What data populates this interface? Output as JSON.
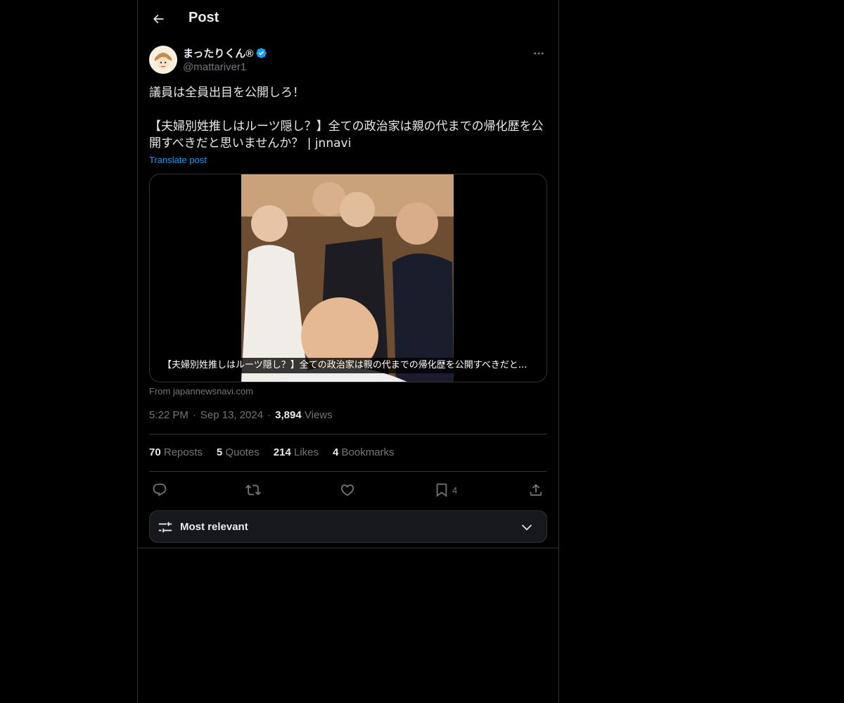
{
  "header": {
    "title": "Post"
  },
  "author": {
    "name": "まったりくん®",
    "handle": "@mattariver1"
  },
  "post": {
    "text": "議員は全員出目を公開しろ！\n\n【夫婦別姓推しはルーツ隠し？】全ての政治家は親の代までの帰化歴を公開すべきだと思いませんか？ | jnnavi",
    "translate_label": "Translate post"
  },
  "card": {
    "caption": "【夫婦別姓推しはルーツ隠し？】全ての政治家は親の代までの帰化歴を公開すべきだと...",
    "source": "From japannewsnavi.com"
  },
  "meta": {
    "time": "5:22 PM",
    "date": "Sep 13, 2024",
    "views_count": "3,894",
    "views_label": "Views"
  },
  "stats": {
    "reposts_count": "70",
    "reposts_label": "Reposts",
    "quotes_count": "5",
    "quotes_label": "Quotes",
    "likes_count": "214",
    "likes_label": "Likes",
    "bookmarks_count": "4",
    "bookmarks_label": "Bookmarks"
  },
  "actions": {
    "bookmark_count": "4"
  },
  "sort": {
    "label": "Most relevant"
  },
  "colors": {
    "background": "#000000",
    "text": "#e7e9ea",
    "muted": "#71767b",
    "accent": "#1d9bf0",
    "border": "#2f3336"
  },
  "icons": [
    "back-arrow-icon",
    "verified-badge-icon",
    "more-icon",
    "reply-icon",
    "repost-icon",
    "like-icon",
    "bookmark-icon",
    "share-icon",
    "sort-sliders-icon",
    "chevron-down-icon"
  ]
}
